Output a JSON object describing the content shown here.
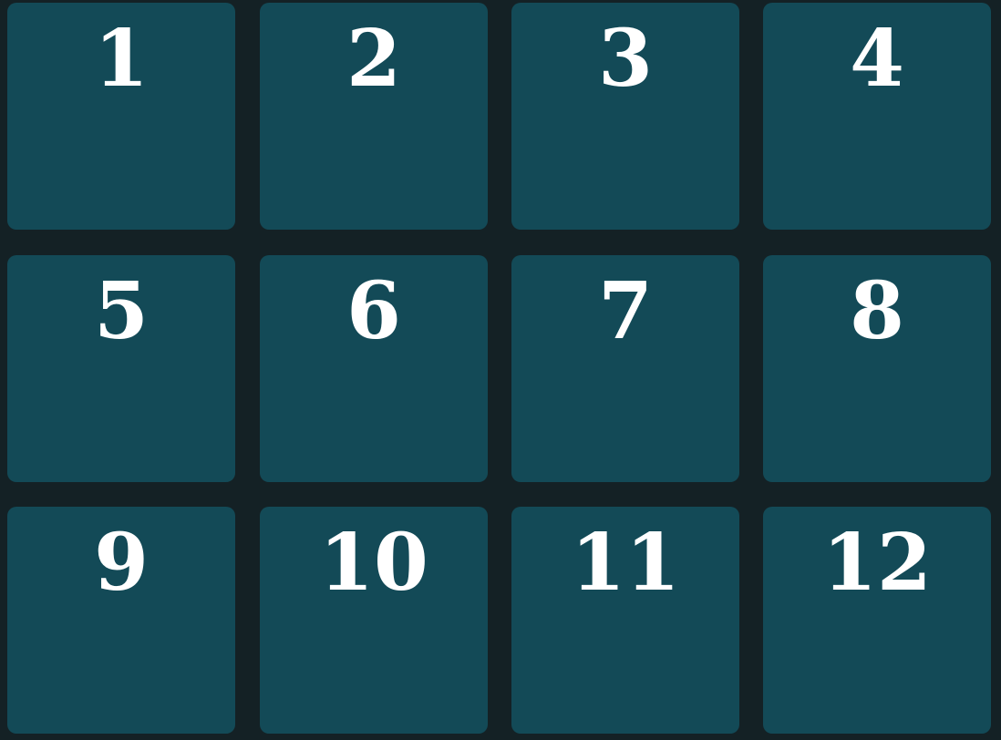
{
  "colors": {
    "background": "#142125",
    "tile": "#134a57",
    "text": "#ffffff"
  },
  "tiles": [
    {
      "label": "1"
    },
    {
      "label": "2"
    },
    {
      "label": "3"
    },
    {
      "label": "4"
    },
    {
      "label": "5"
    },
    {
      "label": "6"
    },
    {
      "label": "7"
    },
    {
      "label": "8"
    },
    {
      "label": "9"
    },
    {
      "label": "10"
    },
    {
      "label": "11"
    },
    {
      "label": "12"
    }
  ]
}
